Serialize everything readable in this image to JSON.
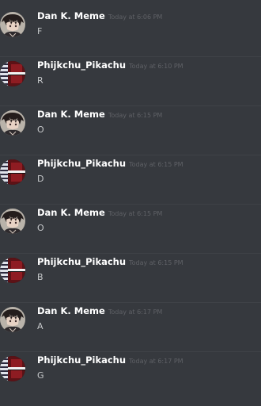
{
  "messages": [
    {
      "avatar": "dark-haired-anime-avatar-icon",
      "username": "Dan K. Meme",
      "timestamp": "Today at 6:06 PM",
      "text": "F"
    },
    {
      "avatar": "pikachu-red-striped-avatar-icon",
      "username": "Phijkchu_Pikachu",
      "timestamp": "Today at 6:10 PM",
      "text": "R"
    },
    {
      "avatar": "dark-haired-anime-avatar-icon",
      "username": "Dan K. Meme",
      "timestamp": "Today at 6:15 PM",
      "text": "O"
    },
    {
      "avatar": "pikachu-red-striped-avatar-icon",
      "username": "Phijkchu_Pikachu",
      "timestamp": "Today at 6:15 PM",
      "text": "D"
    },
    {
      "avatar": "dark-haired-anime-avatar-icon",
      "username": "Dan K. Meme",
      "timestamp": "Today at 6:15 PM",
      "text": "O"
    },
    {
      "avatar": "pikachu-red-striped-avatar-icon",
      "username": "Phijkchu_Pikachu",
      "timestamp": "Today at 6:15 PM",
      "text": "B"
    },
    {
      "avatar": "dark-haired-anime-avatar-icon",
      "username": "Dan K. Meme",
      "timestamp": "Today at 6:17 PM",
      "text": "A"
    },
    {
      "avatar": "pikachu-red-striped-avatar-icon",
      "username": "Phijkchu_Pikachu",
      "timestamp": "Today at 6:17 PM",
      "text": "G"
    }
  ],
  "colors": {
    "background": "#36393e",
    "username": "#ffffff",
    "timestamp": "#5f6166",
    "message_text": "#c7c9cb",
    "divider": "#3f4247"
  }
}
